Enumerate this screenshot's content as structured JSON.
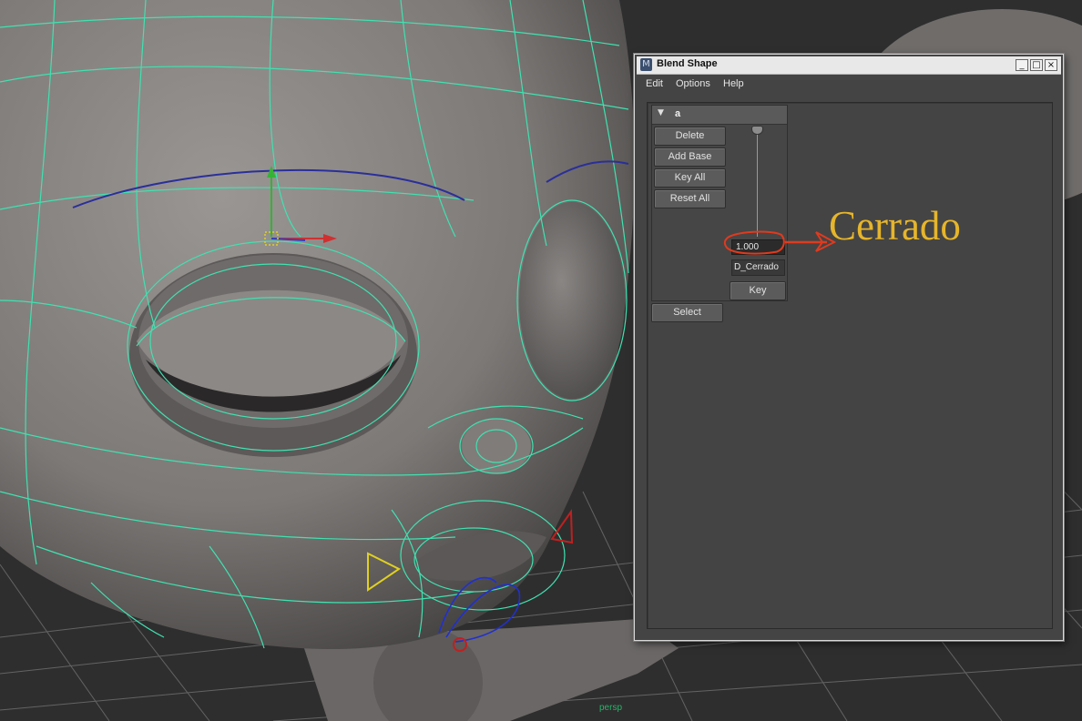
{
  "window": {
    "title": "Blend Shape",
    "controls": [
      "_",
      "□",
      "×"
    ]
  },
  "menu": [
    "Edit",
    "Options",
    "Help"
  ],
  "blend_node": {
    "name": "a",
    "buttons": [
      "Delete",
      "Add Base",
      "Key All",
      "Reset All"
    ],
    "weight_value": "1.000",
    "target_name": "D_Cerrado",
    "key_button": "Key",
    "select_button": "Select"
  },
  "annotation": {
    "text": "Cerrado",
    "color": "#e6b52b",
    "arrow_color": "#e03a1e"
  },
  "viewport": {
    "camera_label": "persp",
    "wireframe_color": "#3fe2b0",
    "mesh_color": "#8a8684"
  }
}
